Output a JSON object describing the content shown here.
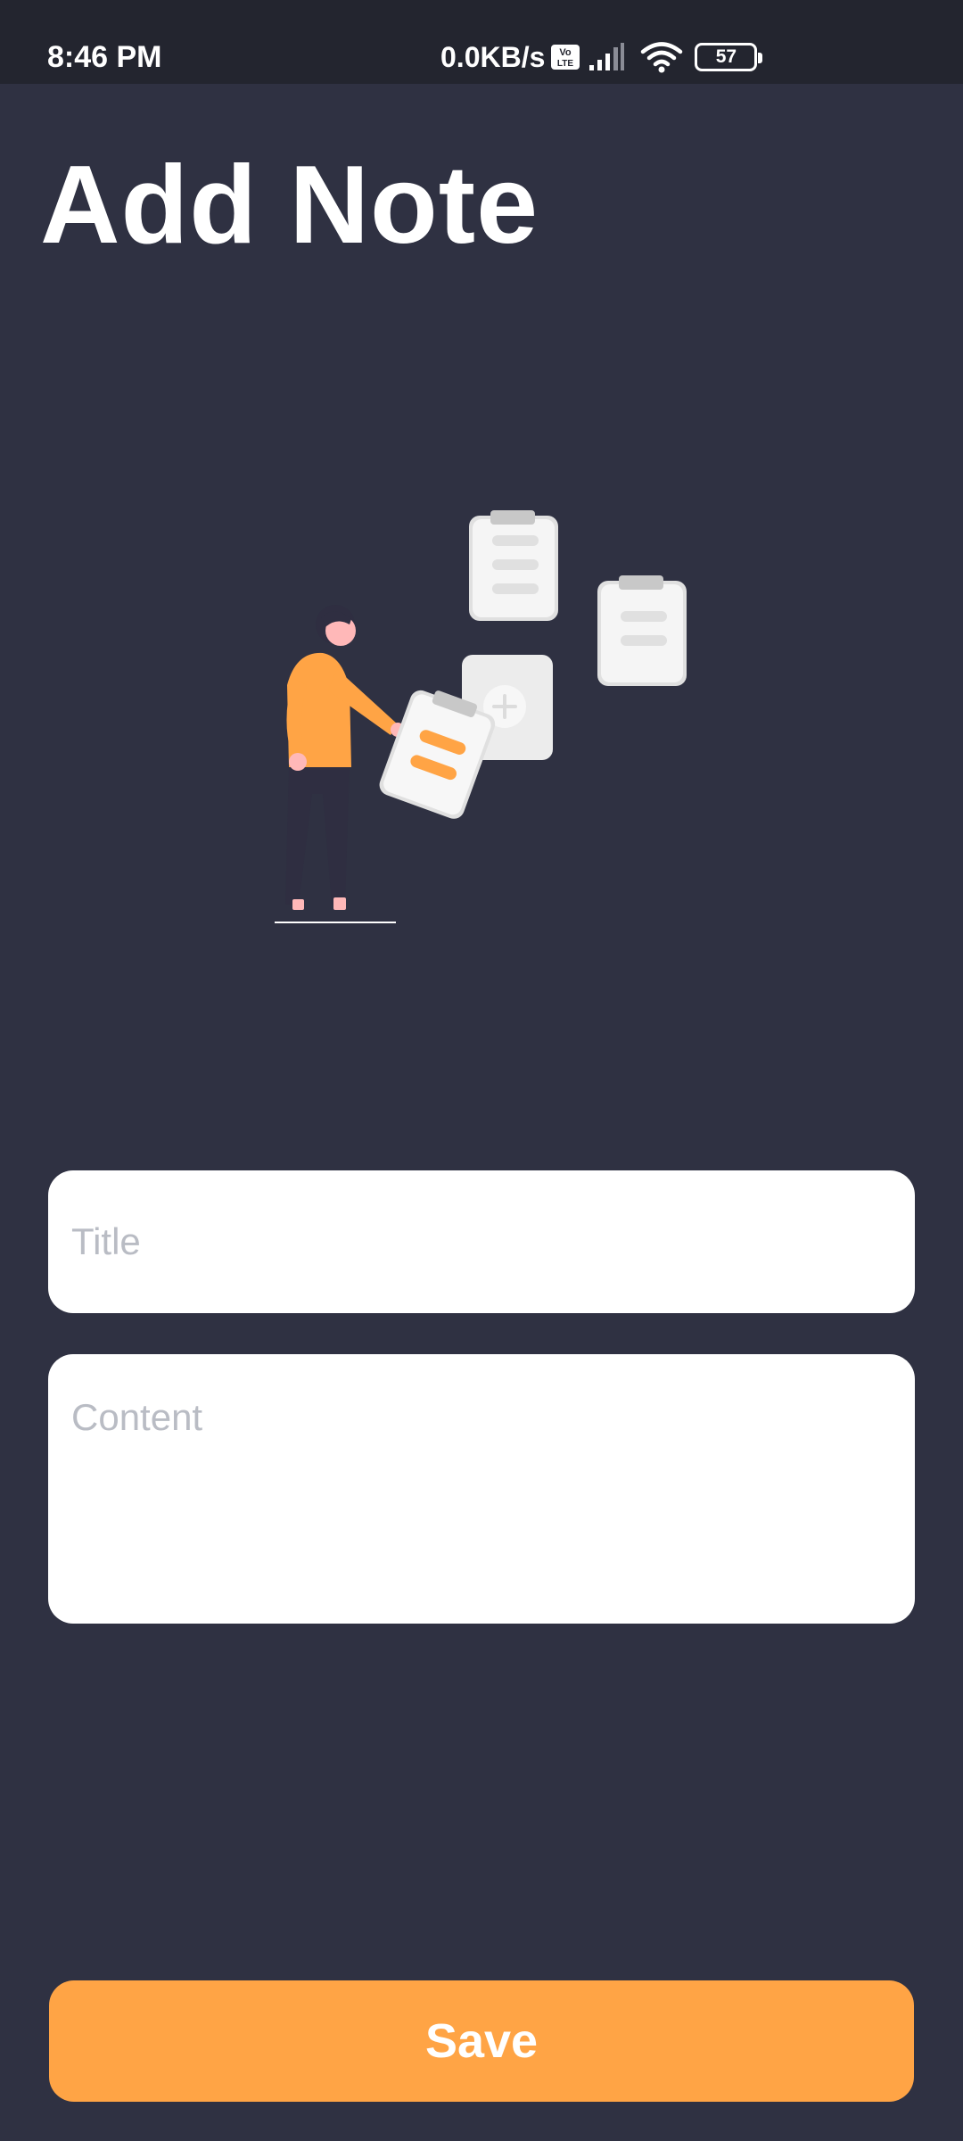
{
  "status_bar": {
    "time": "8:46 PM",
    "net_speed": "0.0KB/s",
    "battery_level": "57",
    "icons": [
      "volte-icon",
      "signal-icon",
      "wifi-icon",
      "battery-icon"
    ]
  },
  "page": {
    "title": "Add Note"
  },
  "illustration": {
    "name": "add-notes-illustration",
    "colors": {
      "accent": "#ffa445",
      "card": "#f2f2f2",
      "card_line": "#e0e0e0",
      "clip": "#c8c8c8",
      "skin": "#ffb8b8",
      "pants": "#2f2e41"
    }
  },
  "form": {
    "title_placeholder": "Title",
    "title_value": "",
    "content_placeholder": "Content",
    "content_value": ""
  },
  "actions": {
    "save_label": "Save"
  },
  "theme": {
    "background": "#2f3142",
    "status_bar_background": "#23252f",
    "accent": "#ffa445",
    "field_background": "#ffffff",
    "placeholder": "#b9bcc4"
  }
}
